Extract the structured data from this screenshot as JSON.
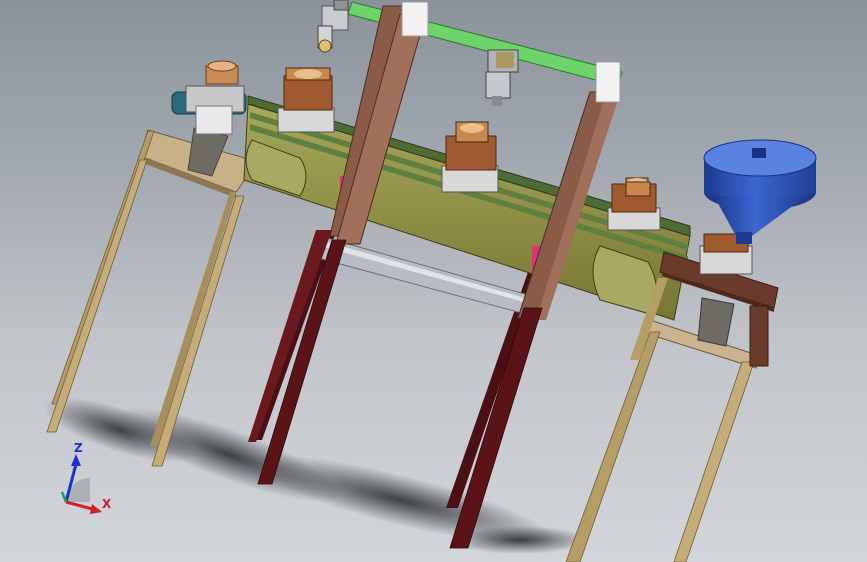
{
  "viewport": {
    "background_top": "#8b929a",
    "background_bottom": "#d2d5d9"
  },
  "colors": {
    "frame_leg_wood": "#b79f68",
    "main_leg_dark_red": "#5a1418",
    "gantry_brown": "#8a5b47",
    "conveyor_olive": "#8d8d3e",
    "gantry_rail_green": "#6ed36a",
    "hopper_blue": "#2f55b8",
    "carrier_copper": "#a05a30",
    "shadow": "#2a2e34"
  },
  "triad": {
    "z_label": "Z",
    "x_label": "X",
    "z_color": "#1c2fd6",
    "x_color": "#d0202a",
    "y_color": "#19a64a"
  }
}
